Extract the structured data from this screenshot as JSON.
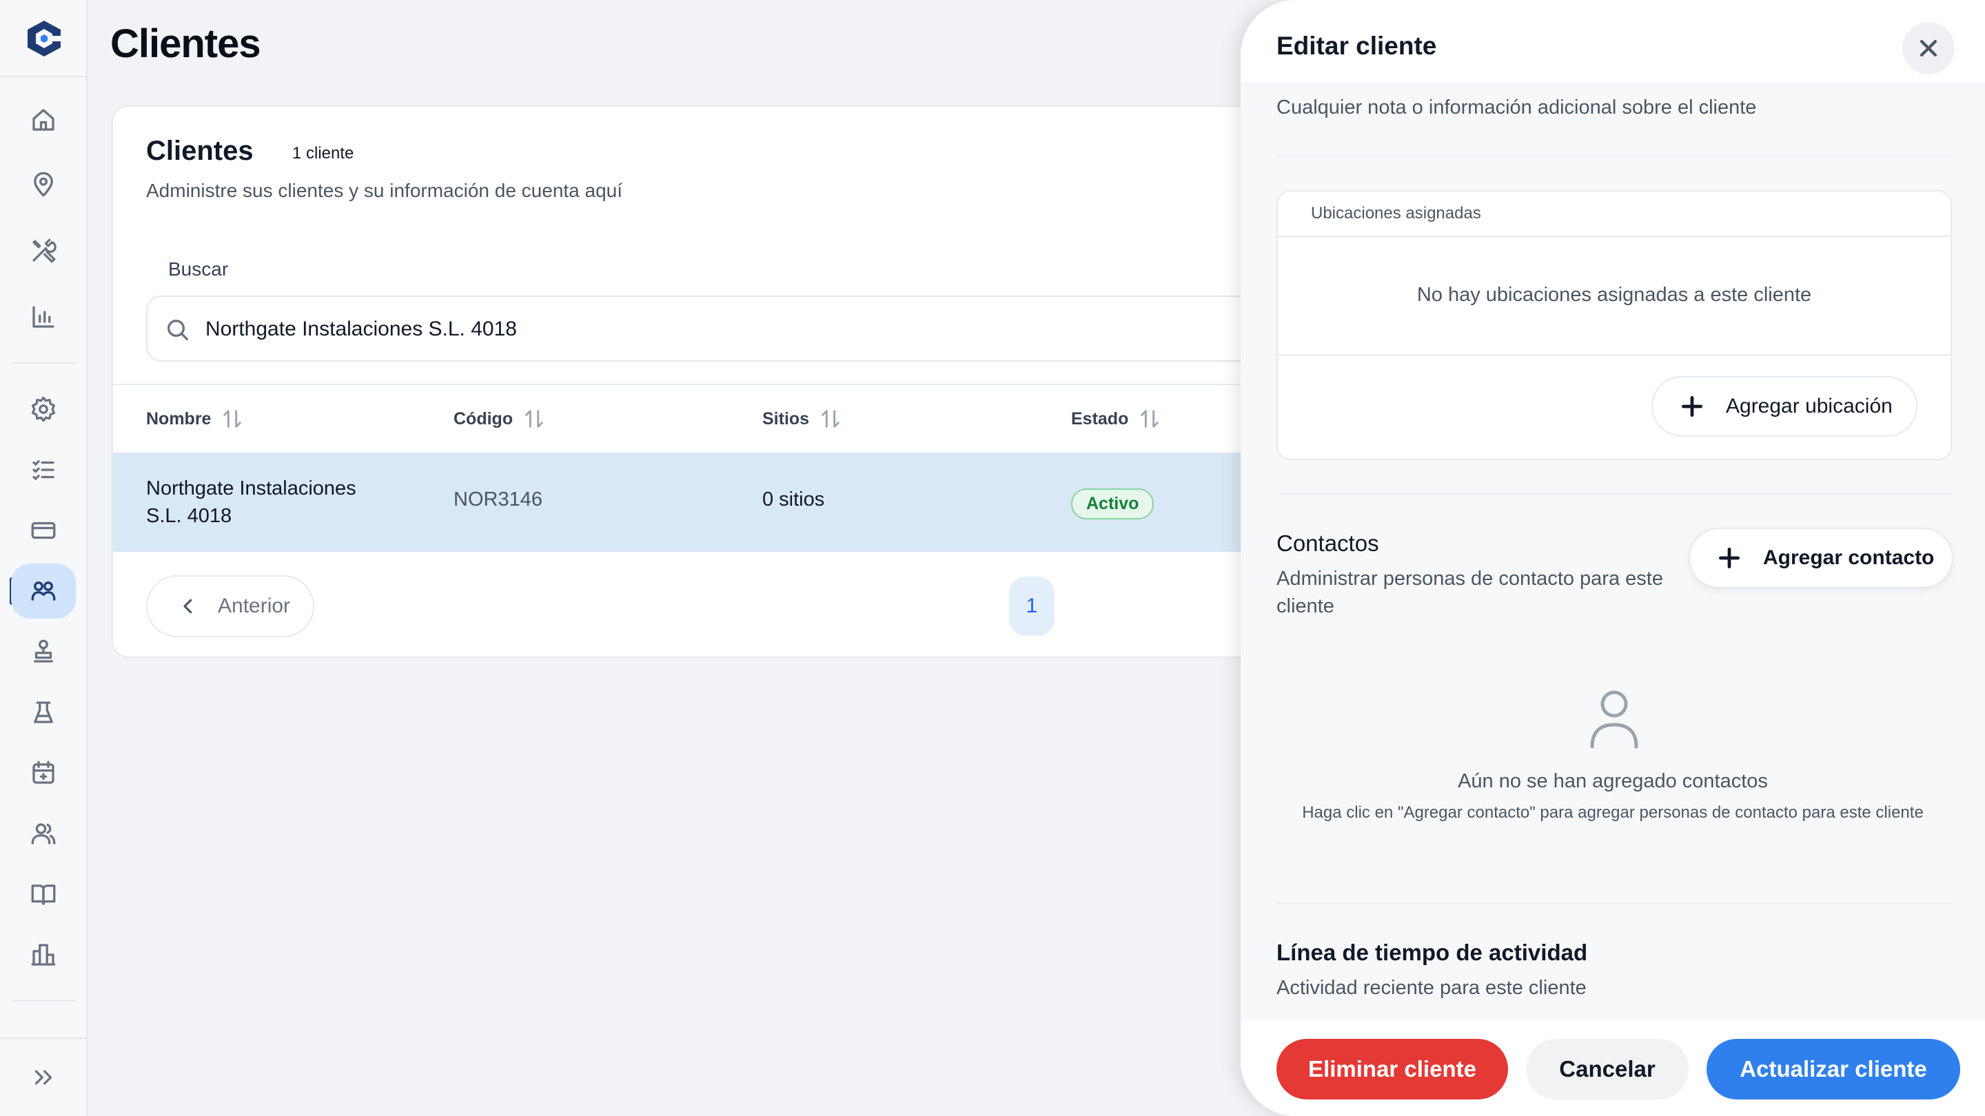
{
  "page": {
    "title": "Clientes"
  },
  "sidebar": {
    "items": [
      {
        "icon": "home-icon"
      },
      {
        "icon": "map-pin-icon"
      },
      {
        "icon": "tools-icon"
      },
      {
        "icon": "bar-chart-icon"
      },
      {
        "icon": "gear-icon"
      },
      {
        "icon": "checklist-icon"
      },
      {
        "icon": "credit-card-icon"
      },
      {
        "icon": "clients-icon",
        "active": true
      },
      {
        "icon": "stamp-icon"
      },
      {
        "icon": "flask-icon"
      },
      {
        "icon": "calendar-icon"
      },
      {
        "icon": "users-icon"
      },
      {
        "icon": "book-icon"
      },
      {
        "icon": "building-icon"
      }
    ],
    "expand_icon": "double-chevron-right-icon"
  },
  "clients_card": {
    "title": "Clientes",
    "count_badge": "1 cliente",
    "subtitle": "Administre sus clientes y su información de cuenta aquí",
    "search_label": "Buscar",
    "search_value": "Northgate Instalaciones S.L. 4018",
    "columns": [
      "Nombre",
      "Código",
      "Sitios",
      "Estado"
    ],
    "rows": [
      {
        "name_line1": "Northgate Instalaciones",
        "name_line2": "S.L. 4018",
        "code": "NOR3146",
        "sites": "0 sitios",
        "status": "Activo"
      }
    ],
    "pagination": {
      "prev_label": "Anterior",
      "current_page": "1"
    }
  },
  "edit_panel": {
    "title": "Editar cliente",
    "note_hint": "Cualquier nota o información adicional sobre el cliente",
    "locations": {
      "header": "Ubicaciones asignadas",
      "empty_text": "No hay ubicaciones asignadas a este cliente",
      "add_label": "Agregar ubicación"
    },
    "contacts": {
      "title": "Contactos",
      "subtitle": "Administrar personas de contacto para este cliente",
      "add_label": "Agregar contacto",
      "empty_title": "Aún no se han agregado contactos",
      "empty_hint": "Haga clic en \"Agregar contacto\" para agregar personas de contacto para este cliente"
    },
    "timeline": {
      "title": "Línea de tiempo de actividad",
      "subtitle": "Actividad reciente para este cliente"
    },
    "footer": {
      "delete_label": "Eliminar cliente",
      "cancel_label": "Cancelar",
      "update_label": "Actualizar cliente"
    }
  },
  "colors": {
    "accent": "#2f80ed",
    "danger": "#e53935",
    "active_nav": "#cfe3fb",
    "status_green": "#15803d",
    "row_selected": "#d9e8f6"
  }
}
